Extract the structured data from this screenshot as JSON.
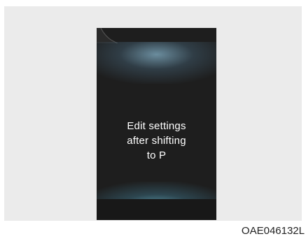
{
  "display": {
    "message_lines": [
      "Edit settings",
      "after shifting",
      "to P"
    ]
  },
  "figure": {
    "code": "OAE046132L"
  },
  "colors": {
    "panel_background": "#ebebeb",
    "screen_background": "#1e1e1e",
    "glow": "#78a0b4",
    "text": "#ffffff"
  }
}
